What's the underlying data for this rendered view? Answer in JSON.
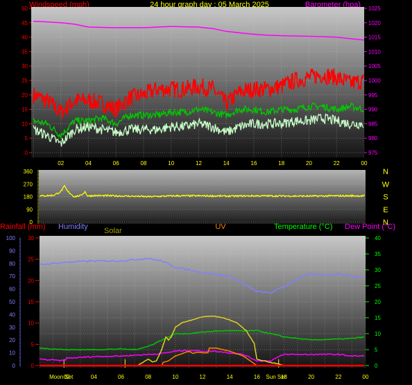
{
  "chart_data": [
    {
      "type": "line",
      "title": "24 hour graph day : 05 March 2025",
      "ylabel": "Windspeed (mph)",
      "y2label": "Barometer (hpa)",
      "ylim": [
        0,
        50
      ],
      "y2lim": [
        975,
        1025
      ],
      "yticks": [
        "0",
        "5",
        "10",
        "15",
        "20",
        "25",
        "30",
        "35",
        "40",
        "45",
        "50"
      ],
      "y2ticks": [
        "975",
        "980",
        "985",
        "990",
        "995",
        "1000",
        "1005",
        "1010",
        "1015",
        "1020",
        "1025"
      ],
      "xticks": [
        "02",
        "04",
        "06",
        "08",
        "10",
        "12",
        "14",
        "16",
        "18",
        "20",
        "22",
        "00"
      ],
      "grid": true,
      "x_hours": [
        0,
        1,
        2,
        3,
        4,
        5,
        6,
        7,
        8,
        9,
        10,
        11,
        12,
        13,
        14,
        15,
        16,
        17,
        18,
        19,
        20,
        21,
        22,
        23,
        24
      ],
      "series": [
        {
          "key": "gust",
          "color": "#ff0000",
          "values": [
            20,
            18,
            14,
            18,
            18,
            17,
            15,
            19,
            20,
            22,
            22,
            22,
            23,
            22,
            17,
            21,
            22,
            22,
            23,
            25,
            26,
            27,
            26,
            24,
            25
          ]
        },
        {
          "key": "average",
          "color": "#00c800",
          "values": [
            11,
            10,
            6,
            11,
            11,
            12,
            10,
            13,
            13,
            13,
            14,
            14,
            15,
            14,
            13,
            15,
            15,
            14,
            15,
            15,
            16,
            16,
            15,
            16,
            15
          ]
        },
        {
          "key": "speed",
          "color": "#c8ffc8",
          "values": [
            8,
            6,
            3,
            8,
            9,
            8,
            7,
            8,
            8,
            8,
            9,
            9,
            10,
            9,
            7,
            9,
            10,
            10,
            10,
            11,
            11,
            12,
            11,
            10,
            10
          ]
        },
        {
          "key": "barometer",
          "color": "#ff00ff",
          "axis": "right",
          "values": [
            1020.5,
            1020.3,
            1020,
            1019.5,
            1018.5,
            1018.4,
            1018.3,
            1018.3,
            1018.3,
            1018.5,
            1018.7,
            1018.6,
            1018.5,
            1018,
            1017,
            1016.5,
            1016,
            1015.7,
            1015.5,
            1015.4,
            1015.3,
            1015.2,
            1015,
            1014.5,
            1014
          ]
        }
      ]
    },
    {
      "type": "line",
      "ylim": [
        0,
        360
      ],
      "yticks": [
        "0",
        "90",
        "180",
        "270",
        "360"
      ],
      "compass": [
        "N",
        "W",
        "S",
        "E",
        "N"
      ],
      "x_hours": [
        0,
        1,
        1.5,
        1.8,
        2,
        2.5,
        3,
        3.3,
        3.5,
        4,
        6,
        8,
        10,
        12,
        14,
        16,
        18,
        20,
        22,
        24
      ],
      "series": [
        {
          "key": "direction",
          "color": "#ffff00",
          "values": [
            185,
            190,
            215,
            255,
            220,
            180,
            188,
            215,
            185,
            188,
            185,
            180,
            186,
            186,
            184,
            186,
            185,
            184,
            186,
            186
          ]
        }
      ],
      "grid": true
    },
    {
      "type": "line",
      "legend": [
        {
          "label": "Rainfall (mm)",
          "color": "#ff0000"
        },
        {
          "label": "Humidity",
          "color": "#8080ff"
        },
        {
          "label": "Solar",
          "color": "#a0a000"
        },
        {
          "label": "UV",
          "color": "#ff8000"
        },
        {
          "label": "Temperature (°C)",
          "color": "#00ff00"
        },
        {
          "label": "Dew Point (°C)",
          "color": "#ff00ff"
        }
      ],
      "humidity_ticks": [
        "0",
        "10",
        "20",
        "30",
        "40",
        "50",
        "60",
        "70",
        "80",
        "90",
        "100"
      ],
      "rain_ticks": [
        "0",
        "5",
        "10",
        "15",
        "20",
        "25",
        "30"
      ],
      "temp_ticks": [
        "0",
        "5",
        "10",
        "15",
        "20",
        "25",
        "30",
        "35",
        "40"
      ],
      "humidity_lim": [
        0,
        100
      ],
      "rain_lim": [
        0,
        30
      ],
      "temp_lim": [
        0,
        40
      ],
      "xticks": [
        "02",
        "04",
        "06",
        "08",
        "10",
        "12",
        "14",
        "16",
        "18",
        "20",
        "22",
        "00"
      ],
      "events": [
        {
          "label": "Moon Set",
          "hour": 1.8
        },
        {
          "label": "Sun Set",
          "hour": 17.6
        }
      ],
      "marker_hours": [
        1.8,
        6.3,
        17.6
      ],
      "grid": true,
      "series": [
        {
          "key": "humidity",
          "axis": "humidity",
          "color": "#8080ff",
          "x": [
            0,
            2,
            4,
            6,
            8,
            9,
            10,
            12,
            14,
            15,
            16,
            17,
            18,
            19,
            20,
            21,
            22,
            23,
            24
          ],
          "values": [
            79,
            81,
            82,
            82,
            84,
            82,
            77,
            73,
            70,
            64,
            58,
            57,
            62,
            68,
            72,
            71,
            72,
            70,
            69
          ]
        },
        {
          "key": "temperature",
          "axis": "temp",
          "color": "#00c800",
          "x": [
            0,
            2,
            4,
            6,
            7,
            8,
            9,
            10,
            11,
            12,
            13,
            14,
            15,
            16,
            17,
            18,
            19,
            20,
            21,
            22,
            23,
            24
          ],
          "values": [
            5.5,
            5,
            5,
            5.2,
            5,
            6,
            8,
            10,
            10,
            10.5,
            10.8,
            11,
            10.8,
            11,
            10,
            9,
            8.5,
            8,
            8.2,
            8.3,
            8.5,
            9
          ]
        },
        {
          "key": "dewpoint",
          "axis": "temp",
          "color": "#ff00ff",
          "x": [
            0,
            1.8,
            2,
            4,
            6,
            8,
            9,
            10,
            11,
            12,
            13,
            14,
            15,
            16,
            17,
            18,
            20,
            22,
            23,
            24
          ],
          "values": [
            2,
            1.5,
            2.3,
            2.8,
            3,
            3.5,
            3.8,
            4.5,
            4.8,
            4.5,
            4.5,
            4,
            3.5,
            1.5,
            1.5,
            3.5,
            3.5,
            3.5,
            3,
            3
          ]
        },
        {
          "key": "solar",
          "axis": "temp",
          "color": "#e0d020",
          "x": [
            0,
            7.2,
            8,
            8.3,
            8.6,
            9,
            9.3,
            9.5,
            9.7,
            10,
            10.5,
            11,
            12,
            12.8,
            13.5,
            14.5,
            15.2,
            15.8,
            16,
            17,
            17.6,
            18,
            24
          ],
          "values": [
            0,
            0,
            2,
            1.2,
            1.5,
            5,
            9,
            8,
            9,
            12,
            13.5,
            14,
            15.3,
            15.5,
            15,
            13.5,
            11,
            7,
            2,
            1,
            0.5,
            0,
            0
          ]
        },
        {
          "key": "uv",
          "axis": "temp",
          "color": "#ff7f00",
          "x": [
            0,
            9,
            9.1,
            9.5,
            10,
            11,
            11.3,
            11.6,
            12,
            12.4,
            12.5,
            13,
            14,
            15,
            16,
            24
          ],
          "values": [
            0,
            0,
            1,
            1.5,
            3,
            4.5,
            3.8,
            4.2,
            4,
            4,
            5.5,
            5.5,
            4.5,
            3,
            0,
            0
          ]
        },
        {
          "key": "rainfall",
          "axis": "rain",
          "color": "#ff0000",
          "x": [
            0,
            24
          ],
          "values": [
            0,
            0
          ]
        }
      ]
    }
  ]
}
